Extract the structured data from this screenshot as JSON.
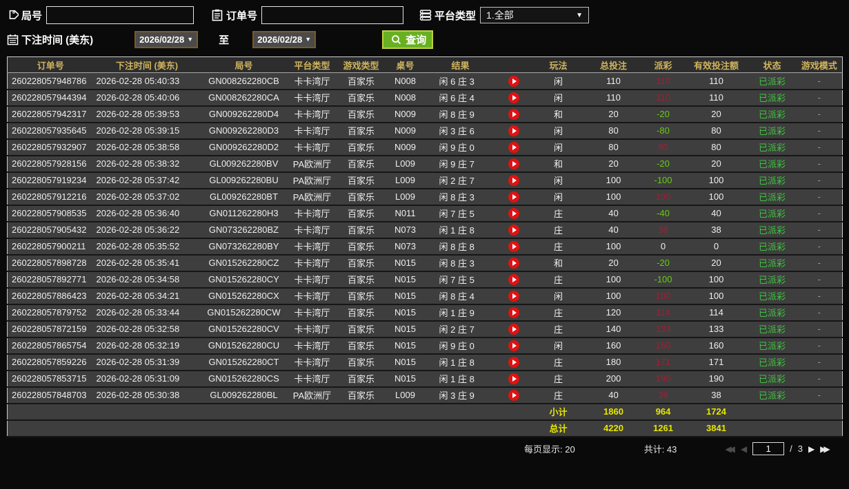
{
  "filters": {
    "round_label": "局号",
    "round_value": "",
    "order_label": "订单号",
    "order_value": "",
    "platform_label": "平台类型",
    "platform_value": "1.全部",
    "bet_time_label": "下注时间 (美东)",
    "date_from": "2026/02/28",
    "to_label": "至",
    "date_to": "2026/02/28",
    "search_label": "查询"
  },
  "table": {
    "columns": [
      "订单号",
      "下注时间 (美东)",
      "局号",
      "平台类型",
      "游戏类型",
      "桌号",
      "结果",
      "",
      "玩法",
      "总投注",
      "派彩",
      "有效投注额",
      "状态",
      "游戏模式"
    ],
    "rows": [
      {
        "order": "260228057948786",
        "time": "2026-02-28 05:40:33",
        "round": "GN008262280CB",
        "platform": "卡卡湾厅",
        "game": "百家乐",
        "table_no": "N008",
        "result": "闲 6 庄 3",
        "bet": "闲",
        "total": "110",
        "payout": "110",
        "valid": "110",
        "status": "已派彩",
        "mode": "-"
      },
      {
        "order": "260228057944394",
        "time": "2026-02-28 05:40:06",
        "round": "GN008262280CA",
        "platform": "卡卡湾厅",
        "game": "百家乐",
        "table_no": "N008",
        "result": "闲 6 庄 4",
        "bet": "闲",
        "total": "110",
        "payout": "110",
        "valid": "110",
        "status": "已派彩",
        "mode": "-"
      },
      {
        "order": "260228057942317",
        "time": "2026-02-28 05:39:53",
        "round": "GN009262280D4",
        "platform": "卡卡湾厅",
        "game": "百家乐",
        "table_no": "N009",
        "result": "闲 8 庄 9",
        "bet": "和",
        "total": "20",
        "payout": "-20",
        "valid": "20",
        "status": "已派彩",
        "mode": "-"
      },
      {
        "order": "260228057935645",
        "time": "2026-02-28 05:39:15",
        "round": "GN009262280D3",
        "platform": "卡卡湾厅",
        "game": "百家乐",
        "table_no": "N009",
        "result": "闲 3 庄 6",
        "bet": "闲",
        "total": "80",
        "payout": "-80",
        "valid": "80",
        "status": "已派彩",
        "mode": "-"
      },
      {
        "order": "260228057932907",
        "time": "2026-02-28 05:38:58",
        "round": "GN009262280D2",
        "platform": "卡卡湾厅",
        "game": "百家乐",
        "table_no": "N009",
        "result": "闲 9 庄 0",
        "bet": "闲",
        "total": "80",
        "payout": "80",
        "valid": "80",
        "status": "已派彩",
        "mode": "-"
      },
      {
        "order": "260228057928156",
        "time": "2026-02-28 05:38:32",
        "round": "GL009262280BV",
        "platform": "PA欧洲厅",
        "game": "百家乐",
        "table_no": "L009",
        "result": "闲 9 庄 7",
        "bet": "和",
        "total": "20",
        "payout": "-20",
        "valid": "20",
        "status": "已派彩",
        "mode": "-"
      },
      {
        "order": "260228057919234",
        "time": "2026-02-28 05:37:42",
        "round": "GL009262280BU",
        "platform": "PA欧洲厅",
        "game": "百家乐",
        "table_no": "L009",
        "result": "闲 2 庄 7",
        "bet": "闲",
        "total": "100",
        "payout": "-100",
        "valid": "100",
        "status": "已派彩",
        "mode": "-"
      },
      {
        "order": "260228057912216",
        "time": "2026-02-28 05:37:02",
        "round": "GL009262280BT",
        "platform": "PA欧洲厅",
        "game": "百家乐",
        "table_no": "L009",
        "result": "闲 8 庄 3",
        "bet": "闲",
        "total": "100",
        "payout": "100",
        "valid": "100",
        "status": "已派彩",
        "mode": "-"
      },
      {
        "order": "260228057908535",
        "time": "2026-02-28 05:36:40",
        "round": "GN011262280H3",
        "platform": "卡卡湾厅",
        "game": "百家乐",
        "table_no": "N011",
        "result": "闲 7 庄 5",
        "bet": "庄",
        "total": "40",
        "payout": "-40",
        "valid": "40",
        "status": "已派彩",
        "mode": "-"
      },
      {
        "order": "260228057905432",
        "time": "2026-02-28 05:36:22",
        "round": "GN073262280BZ",
        "platform": "卡卡湾厅",
        "game": "百家乐",
        "table_no": "N073",
        "result": "闲 1 庄 8",
        "bet": "庄",
        "total": "40",
        "payout": "38",
        "valid": "38",
        "status": "已派彩",
        "mode": "-"
      },
      {
        "order": "260228057900211",
        "time": "2026-02-28 05:35:52",
        "round": "GN073262280BY",
        "platform": "卡卡湾厅",
        "game": "百家乐",
        "table_no": "N073",
        "result": "闲 8 庄 8",
        "bet": "庄",
        "total": "100",
        "payout": "0",
        "valid": "0",
        "status": "已派彩",
        "mode": "-"
      },
      {
        "order": "260228057898728",
        "time": "2026-02-28 05:35:41",
        "round": "GN015262280CZ",
        "platform": "卡卡湾厅",
        "game": "百家乐",
        "table_no": "N015",
        "result": "闲 8 庄 3",
        "bet": "和",
        "total": "20",
        "payout": "-20",
        "valid": "20",
        "status": "已派彩",
        "mode": "-"
      },
      {
        "order": "260228057892771",
        "time": "2026-02-28 05:34:58",
        "round": "GN015262280CY",
        "platform": "卡卡湾厅",
        "game": "百家乐",
        "table_no": "N015",
        "result": "闲 7 庄 5",
        "bet": "庄",
        "total": "100",
        "payout": "-100",
        "valid": "100",
        "status": "已派彩",
        "mode": "-"
      },
      {
        "order": "260228057886423",
        "time": "2026-02-28 05:34:21",
        "round": "GN015262280CX",
        "platform": "卡卡湾厅",
        "game": "百家乐",
        "table_no": "N015",
        "result": "闲 8 庄 4",
        "bet": "闲",
        "total": "100",
        "payout": "100",
        "valid": "100",
        "status": "已派彩",
        "mode": "-"
      },
      {
        "order": "260228057879752",
        "time": "2026-02-28 05:33:44",
        "round": "GN015262280CW",
        "platform": "卡卡湾厅",
        "game": "百家乐",
        "table_no": "N015",
        "result": "闲 1 庄 9",
        "bet": "庄",
        "total": "120",
        "payout": "114",
        "valid": "114",
        "status": "已派彩",
        "mode": "-"
      },
      {
        "order": "260228057872159",
        "time": "2026-02-28 05:32:58",
        "round": "GN015262280CV",
        "platform": "卡卡湾厅",
        "game": "百家乐",
        "table_no": "N015",
        "result": "闲 2 庄 7",
        "bet": "庄",
        "total": "140",
        "payout": "133",
        "valid": "133",
        "status": "已派彩",
        "mode": "-"
      },
      {
        "order": "260228057865754",
        "time": "2026-02-28 05:32:19",
        "round": "GN015262280CU",
        "platform": "卡卡湾厅",
        "game": "百家乐",
        "table_no": "N015",
        "result": "闲 9 庄 0",
        "bet": "闲",
        "total": "160",
        "payout": "160",
        "valid": "160",
        "status": "已派彩",
        "mode": "-"
      },
      {
        "order": "260228057859226",
        "time": "2026-02-28 05:31:39",
        "round": "GN015262280CT",
        "platform": "卡卡湾厅",
        "game": "百家乐",
        "table_no": "N015",
        "result": "闲 1 庄 8",
        "bet": "庄",
        "total": "180",
        "payout": "171",
        "valid": "171",
        "status": "已派彩",
        "mode": "-"
      },
      {
        "order": "260228057853715",
        "time": "2026-02-28 05:31:09",
        "round": "GN015262280CS",
        "platform": "卡卡湾厅",
        "game": "百家乐",
        "table_no": "N015",
        "result": "闲 1 庄 8",
        "bet": "庄",
        "total": "200",
        "payout": "190",
        "valid": "190",
        "status": "已派彩",
        "mode": "-"
      },
      {
        "order": "260228057848703",
        "time": "2026-02-28 05:30:38",
        "round": "GL009262280BL",
        "platform": "PA欧洲厅",
        "game": "百家乐",
        "table_no": "L009",
        "result": "闲 3 庄 9",
        "bet": "庄",
        "total": "40",
        "payout": "38",
        "valid": "38",
        "status": "已派彩",
        "mode": "-"
      }
    ],
    "subtotal": {
      "label": "小计",
      "total": "1860",
      "payout": "964",
      "valid": "1724"
    },
    "grand_total": {
      "label": "总计",
      "total": "4220",
      "payout": "1261",
      "valid": "3841"
    }
  },
  "footer": {
    "page_size_label": "每页显示: 20",
    "total_count_label": "共计: 43",
    "current_page": "1",
    "page_separator": "/",
    "total_pages": "3"
  },
  "colors": {
    "payout_positive": "#9c2136",
    "payout_negative": "#66cc11",
    "status_paid": "#3dc53d",
    "header_text": "#d0b45e",
    "totals_text": "#e6e600",
    "search_button": "#68b021"
  }
}
